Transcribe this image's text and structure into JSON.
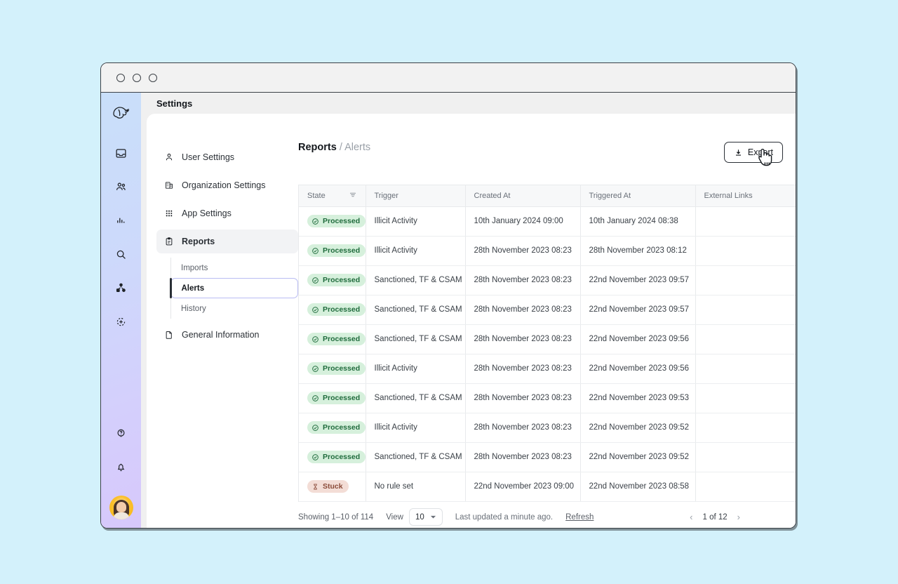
{
  "window": {
    "traffic_lights": [
      "close",
      "minimize",
      "maximize"
    ],
    "app_title": "Settings"
  },
  "rail": {
    "logo_icon": "bird-logo-icon",
    "items": [
      {
        "icon": "inbox-icon",
        "name": "inbox"
      },
      {
        "icon": "people-icon",
        "name": "people"
      },
      {
        "icon": "bar-chart-icon",
        "name": "analytics"
      },
      {
        "icon": "search-icon",
        "name": "search"
      },
      {
        "icon": "network-nodes-icon",
        "name": "network"
      },
      {
        "icon": "refresh-plus-icon",
        "name": "sync"
      }
    ],
    "bottom_items": [
      {
        "icon": "help-circle-icon",
        "name": "help"
      },
      {
        "icon": "bell-icon",
        "name": "notifications"
      }
    ],
    "avatar_name": "user-avatar"
  },
  "settings_nav": {
    "items": [
      {
        "label": "User Settings",
        "icon": "user-icon",
        "active": false
      },
      {
        "label": "Organization Settings",
        "icon": "building-icon",
        "active": false
      },
      {
        "label": "App Settings",
        "icon": "grid-dots-icon",
        "active": false
      },
      {
        "label": "Reports",
        "icon": "clipboard-icon",
        "active": true
      }
    ],
    "sub_items": [
      {
        "label": "Imports",
        "active": false
      },
      {
        "label": "Alerts",
        "active": true
      },
      {
        "label": "History",
        "active": false
      }
    ],
    "general": {
      "label": "General Information",
      "icon": "file-icon"
    }
  },
  "report": {
    "breadcrumb_parent": "Reports",
    "breadcrumb_sep": "/",
    "breadcrumb_current": "Alerts",
    "export_label": "Export",
    "export_icon": "download-icon",
    "cursor_icon": "pointing-hand-cursor"
  },
  "table": {
    "columns": [
      "State",
      "Trigger",
      "Created At",
      "Triggered At",
      "External Links"
    ],
    "filter_icon": "filter-icon",
    "rows": [
      {
        "state": "Processed",
        "state_type": "processed",
        "state_icon": "check-circle-icon",
        "trigger": "Illicit Activity",
        "created": "10th January 2024 09:00",
        "triggered": "10th January 2024 08:38",
        "links": ""
      },
      {
        "state": "Processed",
        "state_type": "processed",
        "state_icon": "check-circle-icon",
        "trigger": "Illicit Activity",
        "created": "28th November 2023 08:23",
        "triggered": "28th November 2023 08:12",
        "links": ""
      },
      {
        "state": "Processed",
        "state_type": "processed",
        "state_icon": "check-circle-icon",
        "trigger": "Sanctioned, TF & CSAM",
        "created": "28th November 2023 08:23",
        "triggered": "22nd November 2023 09:57",
        "links": ""
      },
      {
        "state": "Processed",
        "state_type": "processed",
        "state_icon": "check-circle-icon",
        "trigger": "Sanctioned, TF & CSAM",
        "created": "28th November 2023 08:23",
        "triggered": "22nd November 2023 09:57",
        "links": ""
      },
      {
        "state": "Processed",
        "state_type": "processed",
        "state_icon": "check-circle-icon",
        "trigger": "Sanctioned, TF & CSAM",
        "created": "28th November 2023 08:23",
        "triggered": "22nd November 2023 09:56",
        "links": ""
      },
      {
        "state": "Processed",
        "state_type": "processed",
        "state_icon": "check-circle-icon",
        "trigger": "Illicit Activity",
        "created": "28th November 2023 08:23",
        "triggered": "22nd November 2023 09:56",
        "links": ""
      },
      {
        "state": "Processed",
        "state_type": "processed",
        "state_icon": "check-circle-icon",
        "trigger": "Sanctioned, TF & CSAM",
        "created": "28th November 2023 08:23",
        "triggered": "22nd November 2023 09:53",
        "links": ""
      },
      {
        "state": "Processed",
        "state_type": "processed",
        "state_icon": "check-circle-icon",
        "trigger": "Illicit Activity",
        "created": "28th November 2023 08:23",
        "triggered": "22nd November 2023 09:52",
        "links": ""
      },
      {
        "state": "Processed",
        "state_type": "processed",
        "state_icon": "check-circle-icon",
        "trigger": "Sanctioned, TF & CSAM",
        "created": "28th November 2023 08:23",
        "triggered": "22nd November 2023 09:52",
        "links": ""
      },
      {
        "state": "Stuck",
        "state_type": "stuck",
        "state_icon": "hourglass-icon",
        "trigger": "No rule set",
        "created": "22nd November 2023 09:00",
        "triggered": "22nd November 2023 08:58",
        "links": ""
      }
    ]
  },
  "footer": {
    "showing": "Showing 1–10 of 114",
    "view_label": "View",
    "view_value": "10",
    "last_updated": "Last updated a minute ago.",
    "refresh_label": "Refresh",
    "page_indicator": "1 of 12",
    "prev_icon": "chevron-left-icon",
    "next_icon": "chevron-right-icon"
  },
  "colors": {
    "page_background": "#d3f1fb",
    "rail_gradient_start": "#c9dffa",
    "rail_gradient_end": "#d7c8fb",
    "badge_processed_bg": "#d6f0dc",
    "badge_processed_fg": "#1f6b3c",
    "badge_stuck_bg": "#f3ddd6",
    "badge_stuck_fg": "#8a4a38",
    "active_subnav_border": "#b9bcf3",
    "window_border": "#3c4147"
  }
}
